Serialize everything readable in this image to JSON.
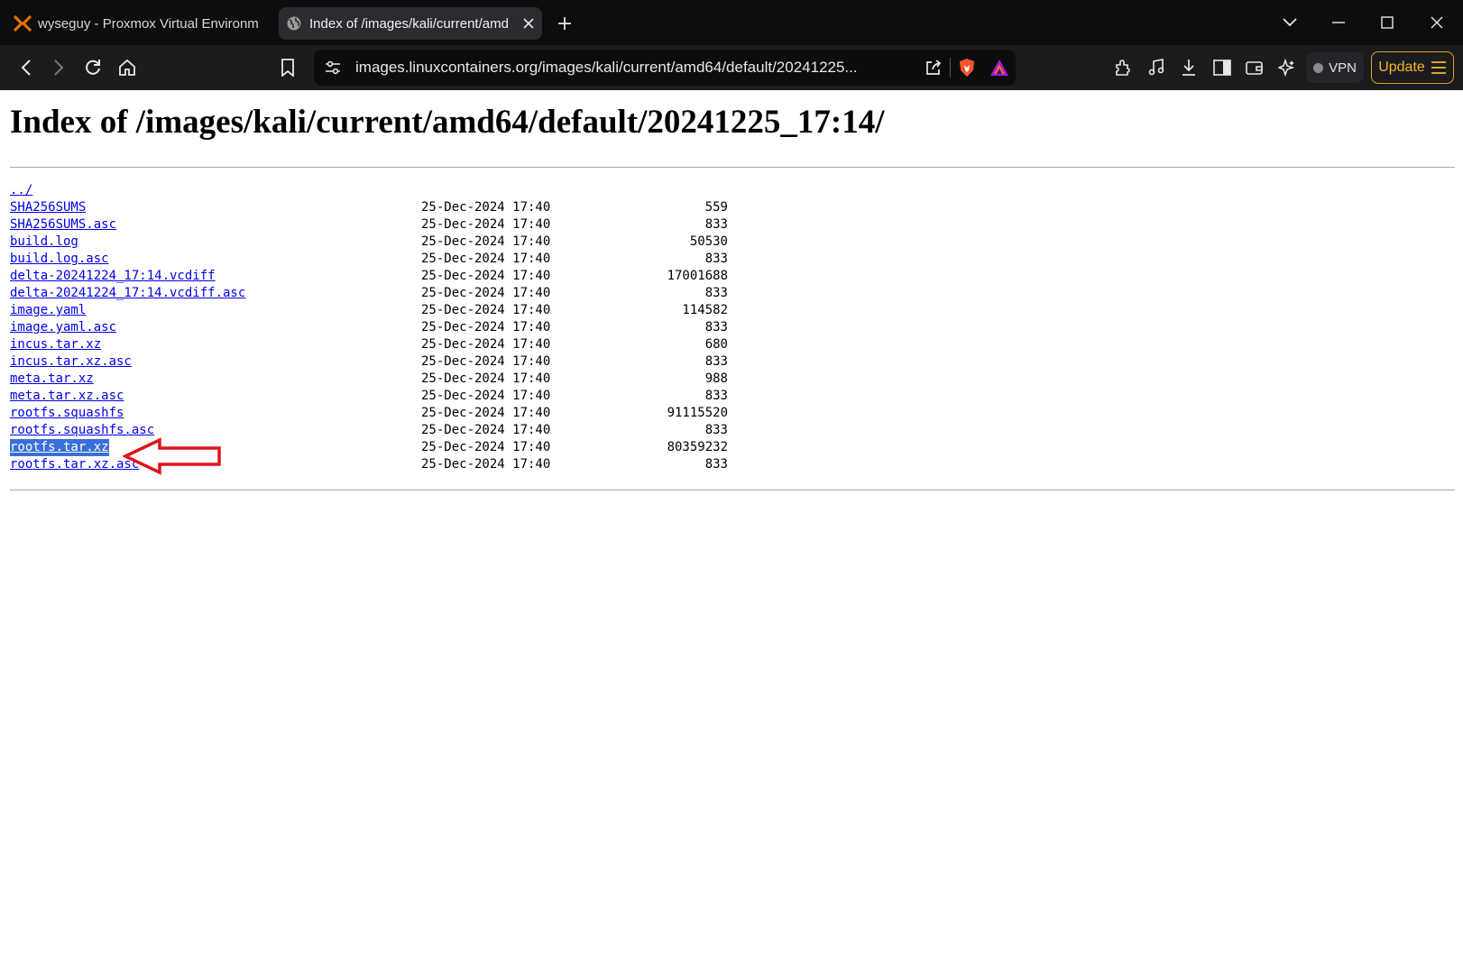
{
  "browser": {
    "tabs": [
      {
        "title": "wyseguy - Proxmox Virtual Environm",
        "icon": "proxmox-icon",
        "active": false
      },
      {
        "title": "Index of /images/kali/current/amd",
        "icon": "globe-icon",
        "active": true
      }
    ],
    "url": "images.linuxcontainers.org/images/kali/current/amd64/default/20241225...",
    "vpn_label": "VPN",
    "update_label": "Update"
  },
  "page": {
    "heading": "Index of /images/kali/current/amd64/default/20241225_17:14/",
    "parent_link": "../",
    "files": [
      {
        "name": "SHA256SUMS",
        "date": "25-Dec-2024 17:40",
        "size": "559"
      },
      {
        "name": "SHA256SUMS.asc",
        "date": "25-Dec-2024 17:40",
        "size": "833"
      },
      {
        "name": "build.log",
        "date": "25-Dec-2024 17:40",
        "size": "50530"
      },
      {
        "name": "build.log.asc",
        "date": "25-Dec-2024 17:40",
        "size": "833"
      },
      {
        "name": "delta-20241224_17:14.vcdiff",
        "date": "25-Dec-2024 17:40",
        "size": "17001688"
      },
      {
        "name": "delta-20241224_17:14.vcdiff.asc",
        "date": "25-Dec-2024 17:40",
        "size": "833"
      },
      {
        "name": "image.yaml",
        "date": "25-Dec-2024 17:40",
        "size": "114582"
      },
      {
        "name": "image.yaml.asc",
        "date": "25-Dec-2024 17:40",
        "size": "833"
      },
      {
        "name": "incus.tar.xz",
        "date": "25-Dec-2024 17:40",
        "size": "680"
      },
      {
        "name": "incus.tar.xz.asc",
        "date": "25-Dec-2024 17:40",
        "size": "833"
      },
      {
        "name": "meta.tar.xz",
        "date": "25-Dec-2024 17:40",
        "size": "988"
      },
      {
        "name": "meta.tar.xz.asc",
        "date": "25-Dec-2024 17:40",
        "size": "833"
      },
      {
        "name": "rootfs.squashfs",
        "date": "25-Dec-2024 17:40",
        "size": "91115520"
      },
      {
        "name": "rootfs.squashfs.asc",
        "date": "25-Dec-2024 17:40",
        "size": "833"
      },
      {
        "name": "rootfs.tar.xz",
        "date": "25-Dec-2024 17:40",
        "size": "80359232",
        "highlighted": true
      },
      {
        "name": "rootfs.tar.xz.asc",
        "date": "25-Dec-2024 17:40",
        "size": "833"
      }
    ],
    "annotation_arrow_color": "#e0141b",
    "link_color": "#0000ee",
    "selection_color": "#3a6fd9"
  }
}
